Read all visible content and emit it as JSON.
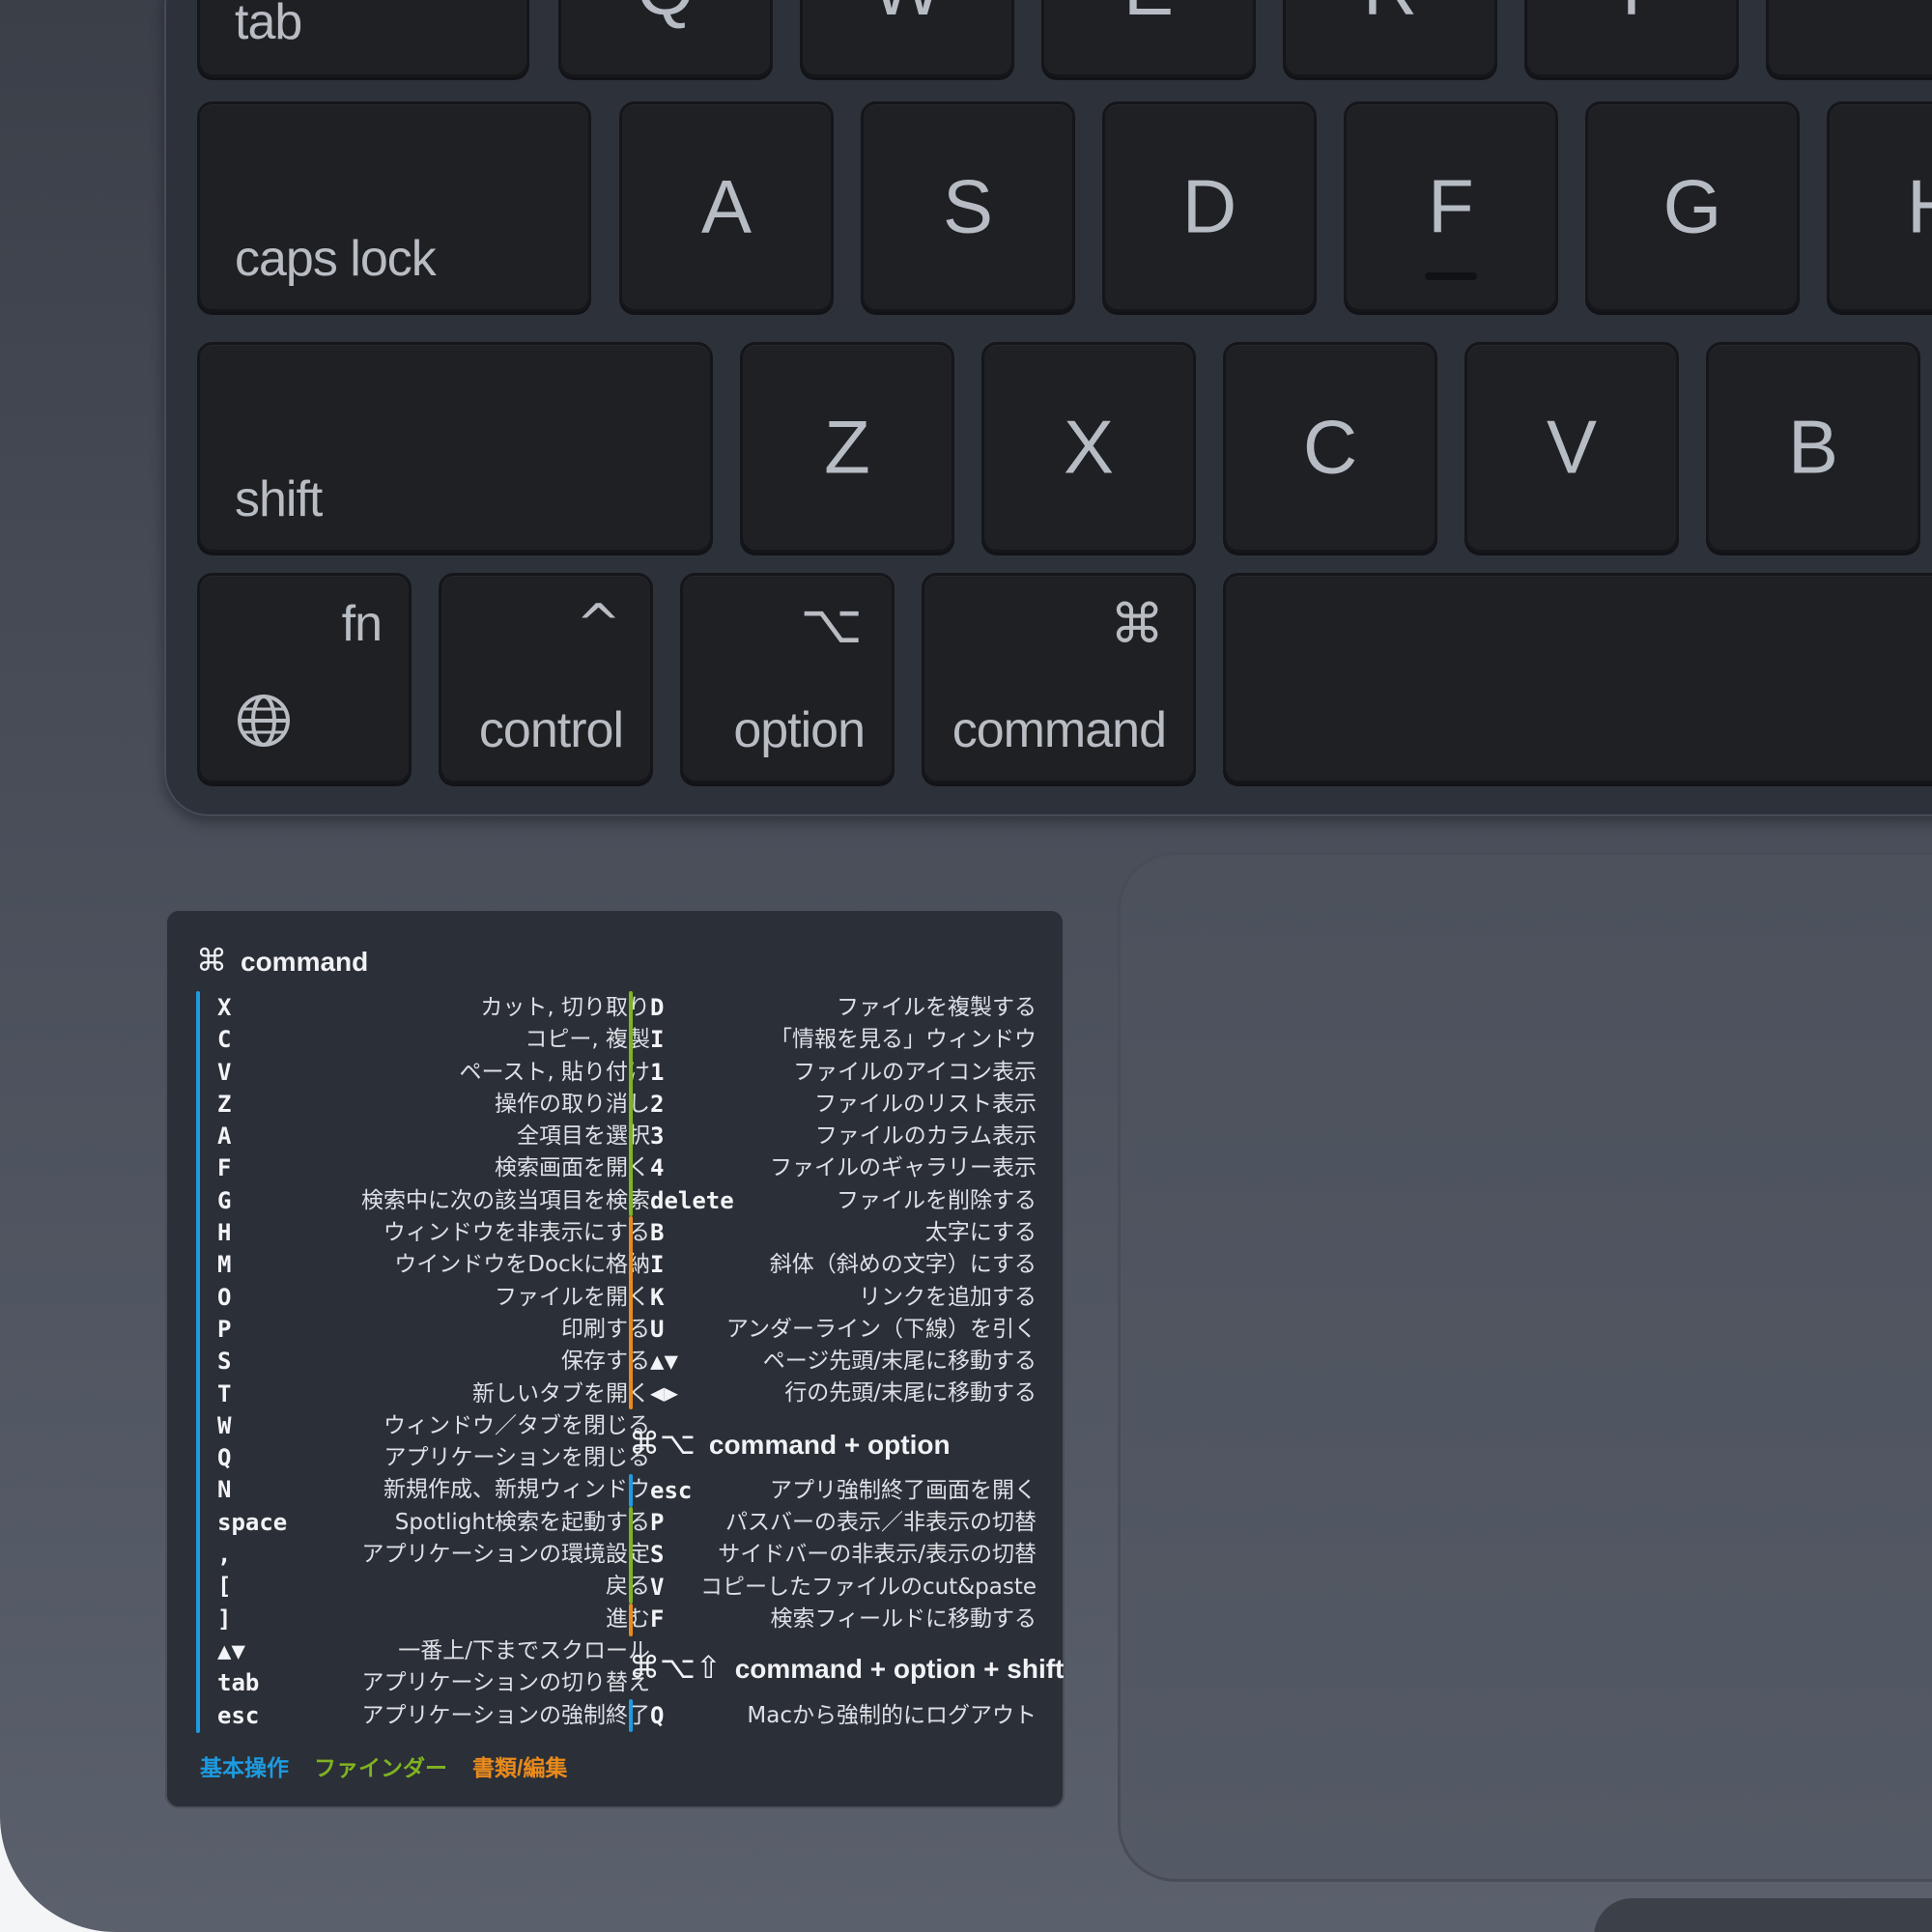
{
  "keyboard": {
    "row_tab": {
      "tab": "tab",
      "letters": [
        "Q",
        "W",
        "E",
        "R",
        "T",
        ""
      ]
    },
    "row_caps": {
      "caps": "caps lock",
      "letters": [
        "A",
        "S",
        "D",
        "F",
        "G",
        "H"
      ]
    },
    "row_shift": {
      "shift": "shift",
      "letters": [
        "Z",
        "X",
        "C",
        "V",
        "B"
      ]
    },
    "row_mod": {
      "fn": "fn",
      "globe_icon": "globe-icon",
      "control": "control",
      "control_sym": "^",
      "option": "option",
      "option_sym": "⌥",
      "command": "command",
      "command_sym": "⌘"
    }
  },
  "cheatsheet": {
    "section_command": {
      "icon": "⌘",
      "title": "command"
    },
    "left_column": [
      {
        "key": "X",
        "desc": "カット, 切り取り"
      },
      {
        "key": "C",
        "desc": "コピー, 複製"
      },
      {
        "key": "V",
        "desc": "ペースト, 貼り付け"
      },
      {
        "key": "Z",
        "desc": "操作の取り消し"
      },
      {
        "key": "A",
        "desc": "全項目を選択"
      },
      {
        "key": "F",
        "desc": "検索画面を開く"
      },
      {
        "key": "G",
        "desc": "検索中に次の該当項目を検索"
      },
      {
        "key": "H",
        "desc": "ウィンドウを非表示にする"
      },
      {
        "key": "M",
        "desc": "ウインドウをDockに格納"
      },
      {
        "key": "O",
        "desc": "ファイルを開く"
      },
      {
        "key": "P",
        "desc": "印刷する"
      },
      {
        "key": "S",
        "desc": "保存する"
      },
      {
        "key": "T",
        "desc": "新しいタブを開く"
      },
      {
        "key": "W",
        "desc": "ウィンドウ／タブを閉じる"
      },
      {
        "key": "Q",
        "desc": "アプリケーションを閉じる"
      },
      {
        "key": "N",
        "desc": "新規作成、新規ウィンドウ"
      },
      {
        "key": "space",
        "desc": "Spotlight検索を起動する"
      },
      {
        "key": ",",
        "desc": "アプリケーションの環境設定"
      },
      {
        "key": "[",
        "desc": "戻る"
      },
      {
        "key": "]",
        "desc": "進む"
      },
      {
        "key": "▲▼",
        "desc": "一番上/下までスクロール"
      },
      {
        "key": "tab",
        "desc": "アプリケーションの切り替え"
      },
      {
        "key": "esc",
        "desc": "アプリケーションの強制終了"
      }
    ],
    "right_finder": [
      {
        "key": "D",
        "desc": "ファイルを複製する"
      },
      {
        "key": "I",
        "desc": "「情報を見る」ウィンドウ"
      },
      {
        "key": "1",
        "desc": "ファイルのアイコン表示"
      },
      {
        "key": "2",
        "desc": "ファイルのリスト表示"
      },
      {
        "key": "3",
        "desc": "ファイルのカラム表示"
      },
      {
        "key": "4",
        "desc": "ファイルのギャラリー表示"
      },
      {
        "key": "delete",
        "desc": "ファイルを削除する"
      }
    ],
    "right_docs": [
      {
        "key": "B",
        "desc": "太字にする"
      },
      {
        "key": "I",
        "desc": "斜体（斜めの文字）にする"
      },
      {
        "key": "K",
        "desc": "リンクを追加する"
      },
      {
        "key": "U",
        "desc": "アンダーライン（下線）を引く"
      },
      {
        "key": "▲▼",
        "desc": "ページ先頭/末尾に移動する"
      },
      {
        "key": "◀▶",
        "desc": "行の先頭/末尾に移動する"
      }
    ],
    "section_cmd_opt": {
      "icon": "⌘⌥",
      "title": "command + option"
    },
    "cmd_opt_basic": [
      {
        "key": "esc",
        "desc": "アプリ強制終了画面を開く"
      }
    ],
    "cmd_opt_finder": [
      {
        "key": "P",
        "desc": "パスバーの表示／非表示の切替"
      },
      {
        "key": "S",
        "desc": "サイドバーの非表示/表示の切替"
      },
      {
        "key": "V",
        "desc": "コピーしたファイルのcut&paste"
      }
    ],
    "cmd_opt_docs": [
      {
        "key": "F",
        "desc": "検索フィールドに移動する"
      }
    ],
    "section_cmd_opt_shift": {
      "icon": "⌘⌥⇧",
      "title": "command + option + shift"
    },
    "cmd_opt_shift": [
      {
        "key": "Q",
        "desc": "Macから強制的にログアウト"
      }
    ],
    "legend": {
      "basic": "基本操作",
      "finder": "ファインダー",
      "docs": "書類/編集"
    },
    "colors": {
      "basic": "#1e9be0",
      "finder": "#7fb321",
      "docs": "#e98a1c"
    }
  }
}
